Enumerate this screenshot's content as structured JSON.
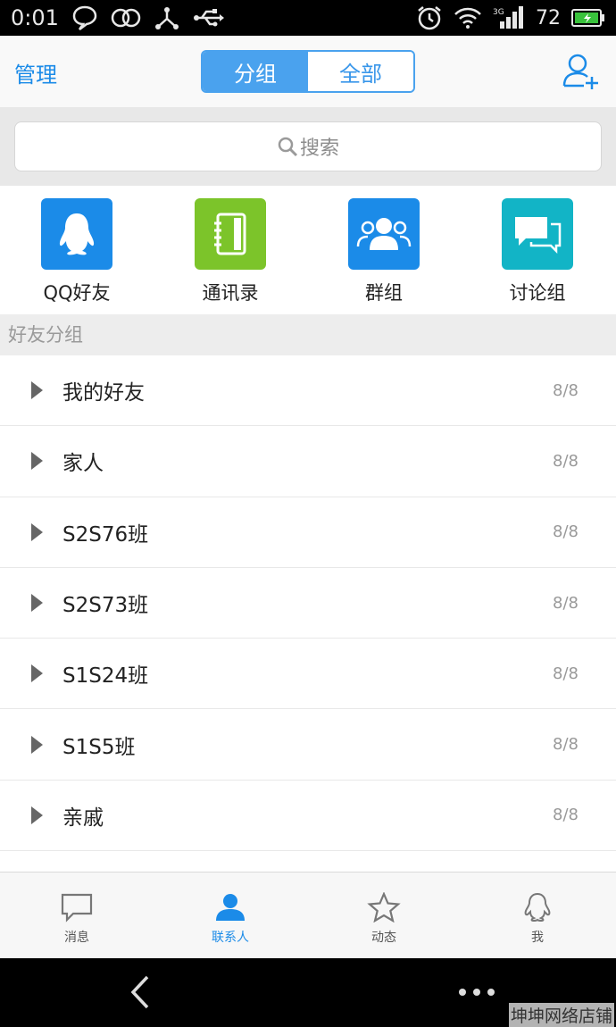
{
  "status_bar": {
    "time": "0:01",
    "battery_level": "72",
    "left_icons": [
      "chat-bubble-icon",
      "circles-icon",
      "tether-icon",
      "usb-icon"
    ],
    "right_icons": [
      "alarm-icon",
      "wifi-icon",
      "signal-3g-icon",
      "battery-charging-icon"
    ]
  },
  "header": {
    "manage_label": "管理",
    "segments": [
      {
        "label": "分组",
        "active": true
      },
      {
        "label": "全部",
        "active": false
      }
    ],
    "add_friend_icon": "add-friend-icon"
  },
  "search": {
    "placeholder": "搜索"
  },
  "quick_entries": [
    {
      "label": "QQ好友",
      "icon": "penguin-icon",
      "color": "#1b8be8"
    },
    {
      "label": "通讯录",
      "icon": "address-book-icon",
      "color": "#7cc42a"
    },
    {
      "label": "群组",
      "icon": "group-icon",
      "color": "#1b8be8"
    },
    {
      "label": "讨论组",
      "icon": "discussion-icon",
      "color": "#12b4c6"
    }
  ],
  "section_title": "好友分组",
  "groups": [
    {
      "name": "我的好友",
      "count": "8/8"
    },
    {
      "name": "家人",
      "count": "8/8"
    },
    {
      "name": "S2S76班",
      "count": "8/8"
    },
    {
      "name": "S2S73班",
      "count": "8/8"
    },
    {
      "name": "S1S24班",
      "count": "8/8"
    },
    {
      "name": "S1S5班",
      "count": "8/8"
    },
    {
      "name": "亲戚",
      "count": "8/8"
    }
  ],
  "tabs": [
    {
      "label": "消息",
      "icon": "message-icon",
      "active": false
    },
    {
      "label": "联系人",
      "icon": "contacts-icon",
      "active": true
    },
    {
      "label": "动态",
      "icon": "star-icon",
      "active": false
    },
    {
      "label": "我",
      "icon": "penguin-outline-icon",
      "active": false
    }
  ],
  "watermark": "坤坤网络店铺",
  "colors": {
    "accent": "#1b8be8",
    "segment_active": "#4aa2ee",
    "address_book": "#7cc42a",
    "discussion": "#12b4c6"
  }
}
